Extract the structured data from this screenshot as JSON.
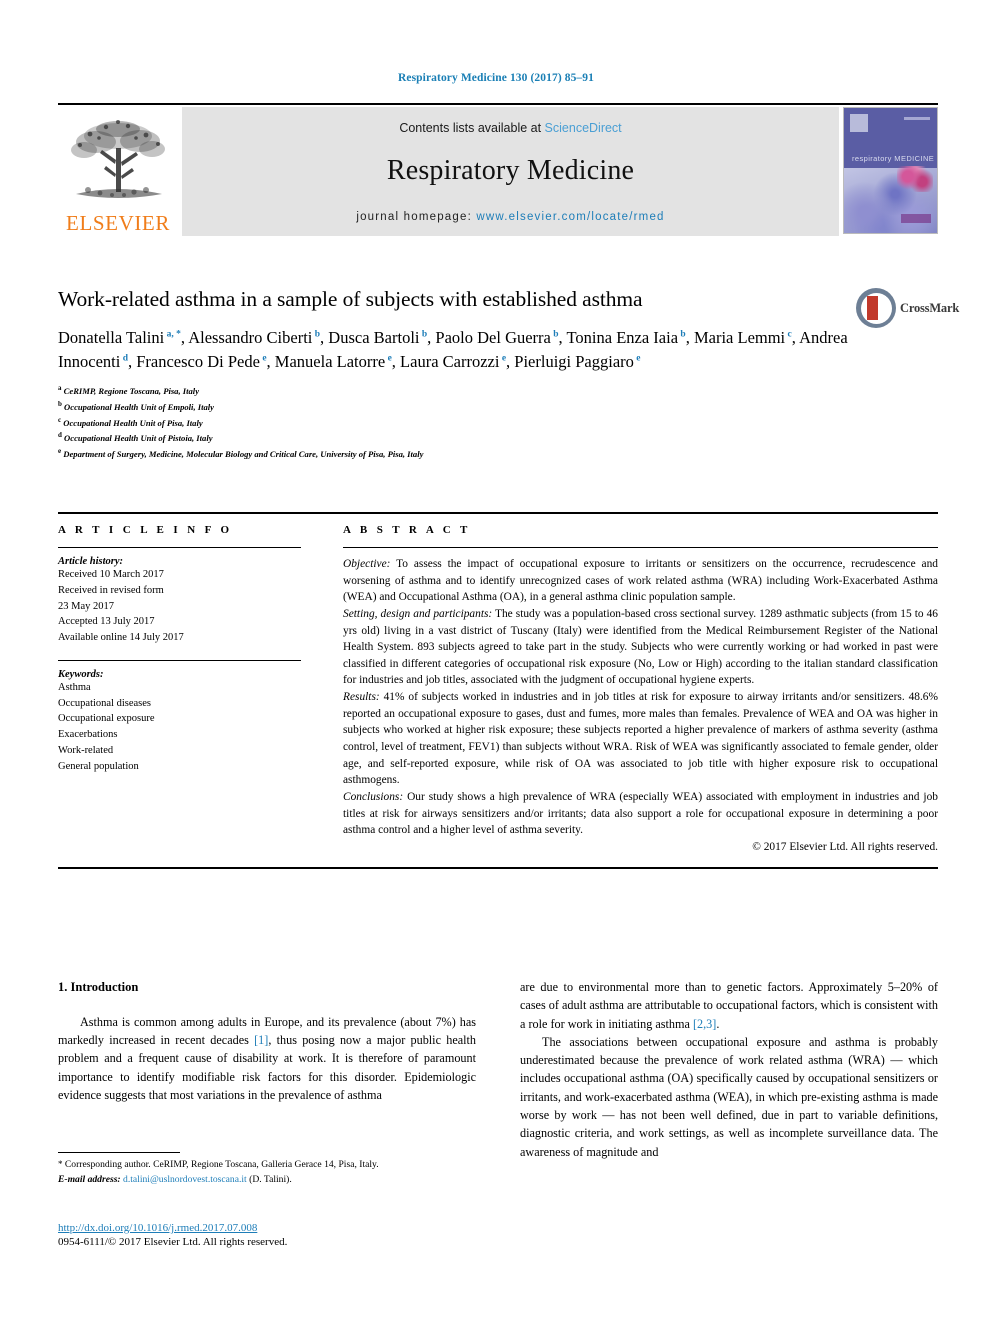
{
  "running_head": "Respiratory Medicine 130 (2017) 85–91",
  "masthead": {
    "publisher": "ELSEVIER",
    "contents_prefix": "Contents lists available at ",
    "contents_link": "ScienceDirect",
    "journal_title": "Respiratory Medicine",
    "homepage_label": "journal homepage:",
    "homepage_url": "www.elsevier.com/locate/rmed",
    "cover": {
      "journal_name": "respiratory MEDICINE"
    }
  },
  "article": {
    "title": "Work-related asthma in a sample of subjects with established asthma",
    "crossmark_label": "CrossMark",
    "authors": [
      {
        "name": "Donatella Talini",
        "marks": "a, *"
      },
      {
        "name": "Alessandro Ciberti",
        "marks": "b"
      },
      {
        "name": "Dusca Bartoli",
        "marks": "b"
      },
      {
        "name": "Paolo Del Guerra",
        "marks": "b"
      },
      {
        "name": "Tonina Enza Iaia",
        "marks": "b"
      },
      {
        "name": "Maria Lemmi",
        "marks": "c"
      },
      {
        "name": "Andrea Innocenti",
        "marks": "d"
      },
      {
        "name": "Francesco Di Pede",
        "marks": "e"
      },
      {
        "name": "Manuela Latorre",
        "marks": "e"
      },
      {
        "name": "Laura Carrozzi",
        "marks": "e"
      },
      {
        "name": "Pierluigi Paggiaro",
        "marks": "e"
      }
    ],
    "affiliations": [
      {
        "mark": "a",
        "text": "CeRIMP, Regione Toscana, Pisa, Italy"
      },
      {
        "mark": "b",
        "text": "Occupational Health Unit of Empoli, Italy"
      },
      {
        "mark": "c",
        "text": "Occupational Health Unit of Pisa, Italy"
      },
      {
        "mark": "d",
        "text": "Occupational Health Unit of Pistoia, Italy"
      },
      {
        "mark": "e",
        "text": "Department of Surgery, Medicine, Molecular Biology and Critical Care, University of Pisa, Pisa, Italy"
      }
    ]
  },
  "article_info": {
    "heading": "A R T I C L E  I N F O",
    "history_title": "Article history:",
    "history": [
      "Received 10 March 2017",
      "Received in revised form",
      "23 May 2017",
      "Accepted 13 July 2017",
      "Available online 14 July 2017"
    ],
    "keywords_title": "Keywords:",
    "keywords": [
      "Asthma",
      "Occupational diseases",
      "Occupational exposure",
      "Exacerbations",
      "Work-related",
      "General population"
    ]
  },
  "abstract": {
    "heading": "A B S T R A C T",
    "sections": [
      {
        "label": "Objective:",
        "text": " To assess the impact of occupational exposure to irritants or sensitizers on the occurrence, recrudescence and worsening of asthma and to identify unrecognized cases of work related asthma (WRA) including Work-Exacerbated Asthma (WEA) and Occupational Asthma (OA), in a general asthma clinic population sample."
      },
      {
        "label": "Setting, design and participants:",
        "text": " The study was a population-based cross sectional survey. 1289 asthmatic subjects (from 15 to 46 yrs old) living in a vast district of Tuscany (Italy) were identified from the Medical Reimbursement Register of the National Health System. 893 subjects agreed to take part in the study. Subjects who were currently working or had worked in past were classified in different categories of occupational risk exposure (No, Low or High) according to the italian standard classification for industries and job titles, associated with the judgment of occupational hygiene experts."
      },
      {
        "label": "Results:",
        "text": " 41% of subjects worked in industries and in job titles at risk for exposure to airway irritants and/or sensitizers. 48.6% reported an occupational exposure to gases, dust and fumes, more males than females. Prevalence of WEA and OA was higher in subjects who worked at higher risk exposure; these subjects reported a higher prevalence of markers of asthma severity (asthma control, level of treatment, FEV1) than subjects without WRA. Risk of WEA was significantly associated to female gender, older age, and self-reported exposure, while risk of OA was associated to job title with higher exposure risk to occupational asthmogens."
      },
      {
        "label": "Conclusions:",
        "text": " Our study shows a high prevalence of WRA (especially WEA) associated with employment in industries and job titles at risk for airways sensitizers and/or irritants; data also support a role for occupational exposure in determining a poor asthma control and a higher level of asthma severity."
      }
    ],
    "copyright": "© 2017 Elsevier Ltd. All rights reserved."
  },
  "introduction": {
    "heading": "1. Introduction",
    "left_paragraph_part1": "Asthma is common among adults in Europe, and its prevalence (about 7%) has markedly increased in recent decades ",
    "left_ref1": "[1]",
    "left_paragraph_part2": ", thus posing now a major public health problem and a frequent cause of disability at work. It is therefore of paramount importance to identify modifiable risk factors for this disorder. Epidemiologic evidence suggests that most variations in the prevalence of asthma",
    "right_paragraph1_part1": "are due to environmental more than to genetic factors. Approximately 5–20% of cases of adult asthma are attributable to occupational factors, which is consistent with a role for work in initiating asthma ",
    "right_ref1": "[2,3]",
    "right_paragraph1_part2": ".",
    "right_paragraph2": "The associations between occupational exposure and asthma is probably underestimated because the prevalence of work related asthma (WRA) — which includes occupational asthma (OA) specifically caused by occupational sensitizers or irritants, and work-exacerbated asthma (WEA), in which pre-existing asthma is made worse by work — has not been well defined, due in part to variable definitions, diagnostic criteria, and work settings, as well as incomplete surveillance data. The awareness of magnitude and"
  },
  "footer": {
    "corresponding_star": "*",
    "corresponding_text": " Corresponding author. CeRIMP, Regione Toscana, Galleria Gerace 14, Pisa, Italy.",
    "email_label": "E-mail address:",
    "email": "d.talini@uslnordovest.toscana.it",
    "email_suffix": " (D. Talini).",
    "doi": "http://dx.doi.org/10.1016/j.rmed.2017.07.008",
    "issn_line": "0954-6111/© 2017 Elsevier Ltd. All rights reserved."
  },
  "colors": {
    "link_blue": "#1d7db8",
    "elsevier_orange": "#f07d1a",
    "masthead_gray": "#e3e3e3",
    "crossmark_red": "#c1392b"
  }
}
